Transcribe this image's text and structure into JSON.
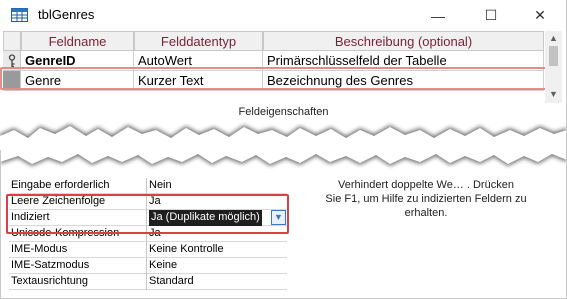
{
  "window": {
    "title": "tblGenres",
    "controls": {
      "minimize": "—",
      "maximize": "☐",
      "close": "✕"
    }
  },
  "fields_grid": {
    "headers": [
      "Feldname",
      "Felddatentyp",
      "Beschreibung (optional)"
    ],
    "rows": [
      {
        "name": "GenreID",
        "type": "AutoWert",
        "description": "Primärschlüsselfeld der Tabelle",
        "primary_key": true
      },
      {
        "name": "Genre",
        "type": "Kurzer Text",
        "description": "Bezeichnung des Genres",
        "primary_key": false
      }
    ]
  },
  "properties_section_label": "Feldeigenschaften",
  "properties": [
    {
      "key": "Eingabe erforderlich",
      "value": "Nein"
    },
    {
      "key": "Leere Zeichenfolge",
      "value": "Ja"
    },
    {
      "key": "Indiziert",
      "value": "Ja (Duplikate möglich)"
    },
    {
      "key": "Unicode-Kompression",
      "value": "Ja"
    },
    {
      "key": "IME-Modus",
      "value": "Keine Kontrolle"
    },
    {
      "key": "IME-Satzmodus",
      "value": "Keine"
    },
    {
      "key": "Textausrichtung",
      "value": "Standard"
    }
  ],
  "help_text": {
    "line1": "Verhindert doppelte We… . Drücken",
    "line2": "Sie F1, um Hilfe zu indizierten Feldern zu",
    "line3": "erhalten."
  },
  "colors": {
    "header_text": "#7a1f35",
    "highlight_light": "#e38c8c",
    "highlight_dark": "#d94242",
    "dropdown_accent": "#3c78c4"
  }
}
